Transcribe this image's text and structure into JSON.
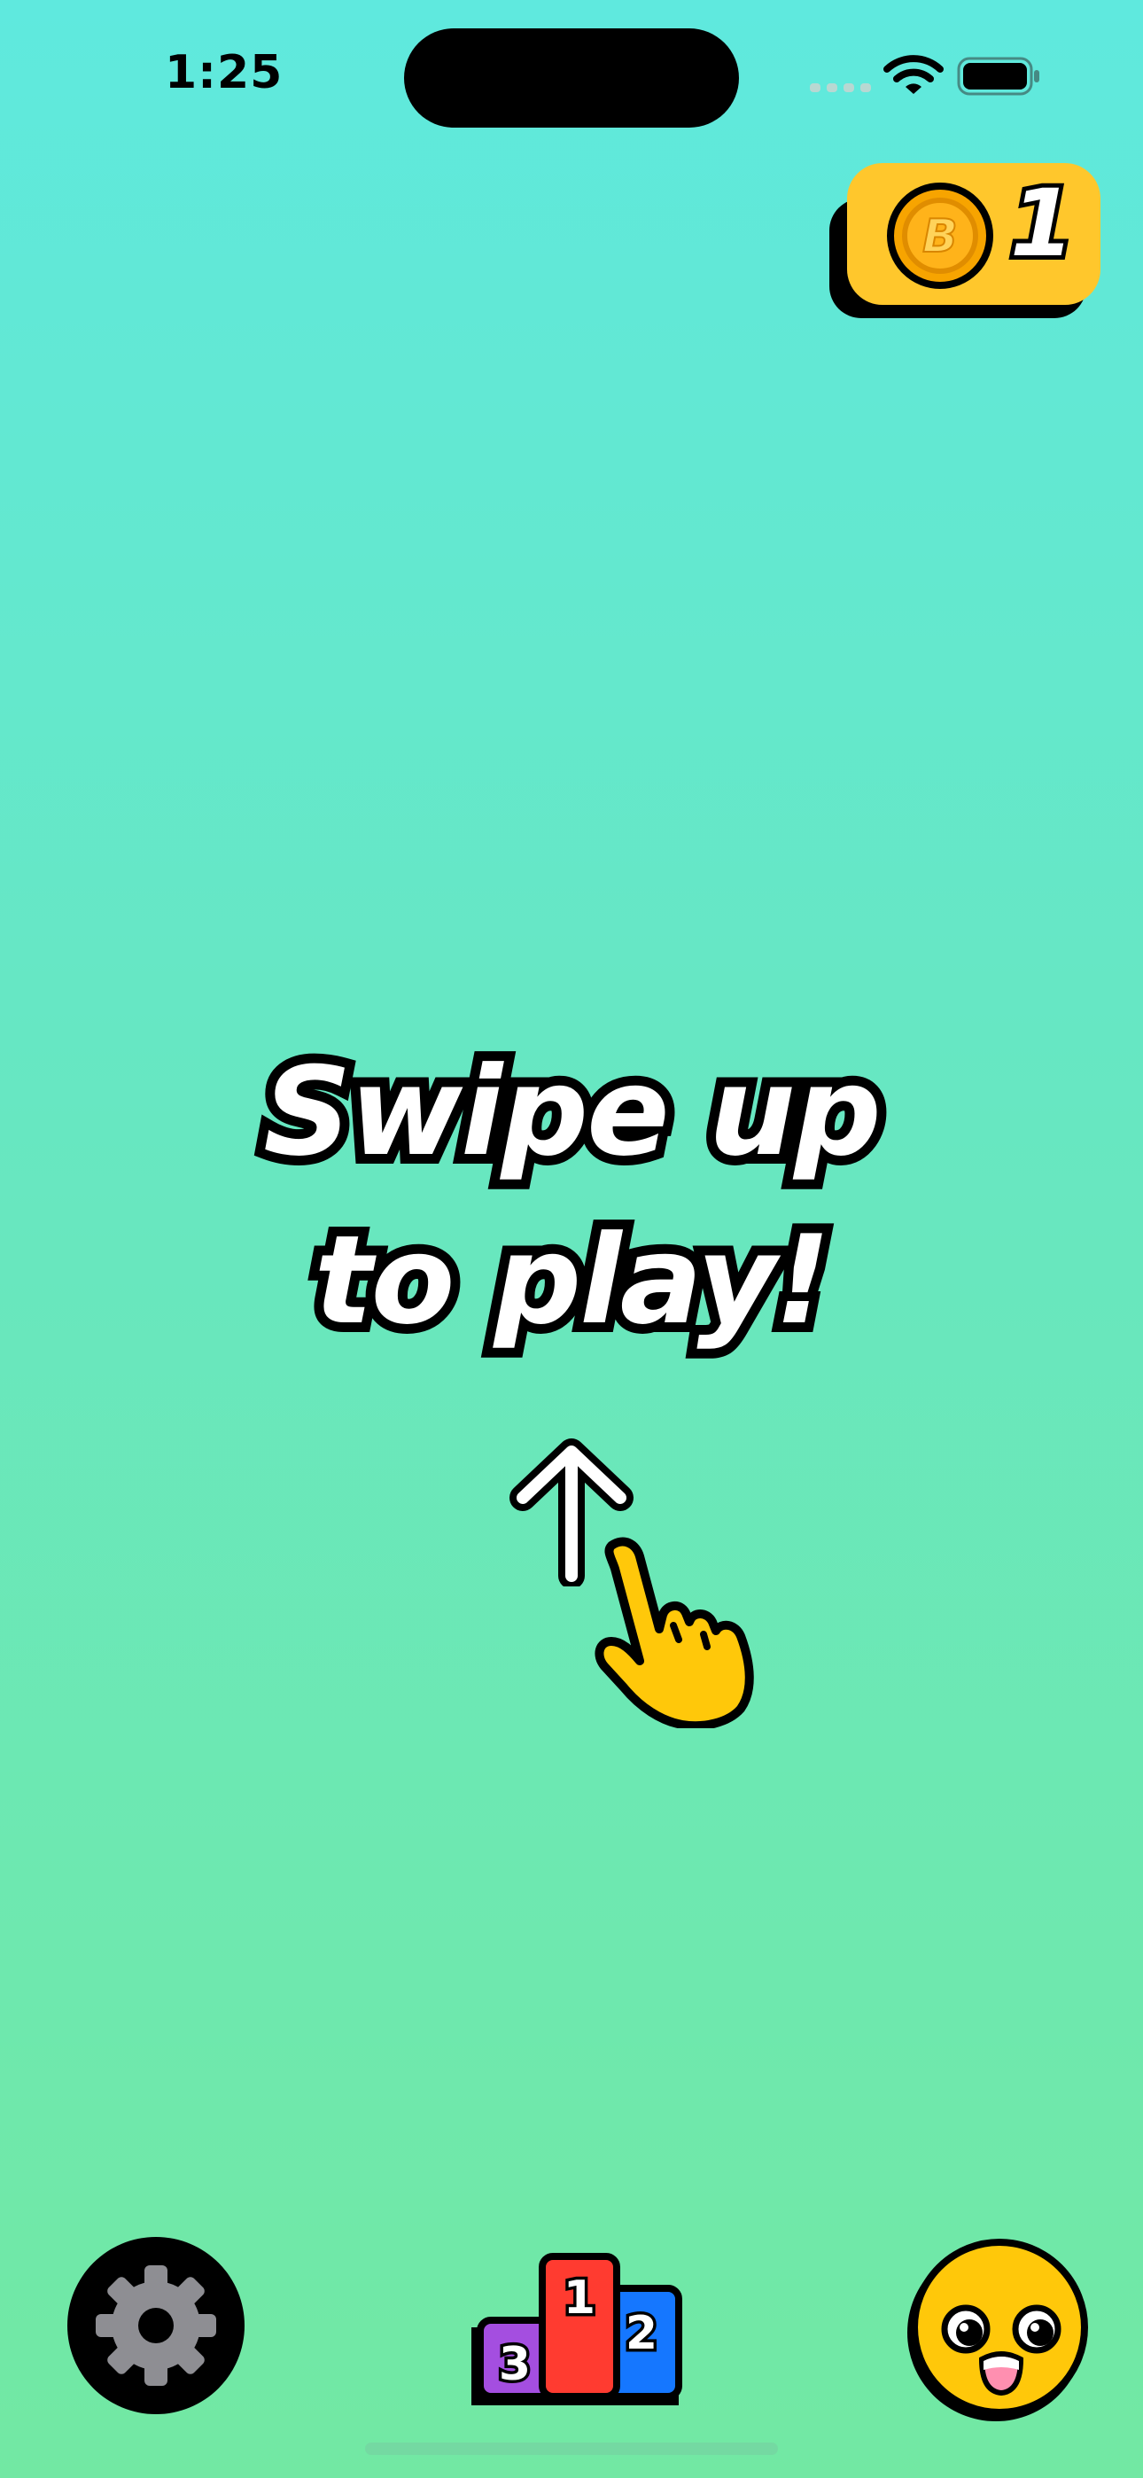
{
  "status_bar": {
    "time": "1:25",
    "icons": [
      "cellular-signal-icon",
      "wifi-icon",
      "battery-icon"
    ]
  },
  "coins": {
    "icon": "coin-b-icon",
    "coin_symbol": "B",
    "count": "1"
  },
  "prompt": {
    "line1": "Swipe up",
    "line2": "to play!"
  },
  "gesture_hint": {
    "arrow_icon": "up-arrow-icon",
    "hand_icon": "pointing-hand-icon"
  },
  "bottom_bar": {
    "settings_icon": "gear-icon",
    "leaderboard": {
      "icon": "podium-icon",
      "places": [
        "1",
        "2",
        "3"
      ]
    },
    "character_icon": "smiley-face-icon"
  },
  "colors": {
    "background_top": "#5fe9de",
    "background_bottom": "#72e8a3",
    "coin_pill": "#ffc72c",
    "coin": "#f5a000",
    "podium_first": "#ff3b30",
    "podium_second": "#1577ff",
    "podium_third": "#a44ee0",
    "face": "#ffc80a"
  }
}
